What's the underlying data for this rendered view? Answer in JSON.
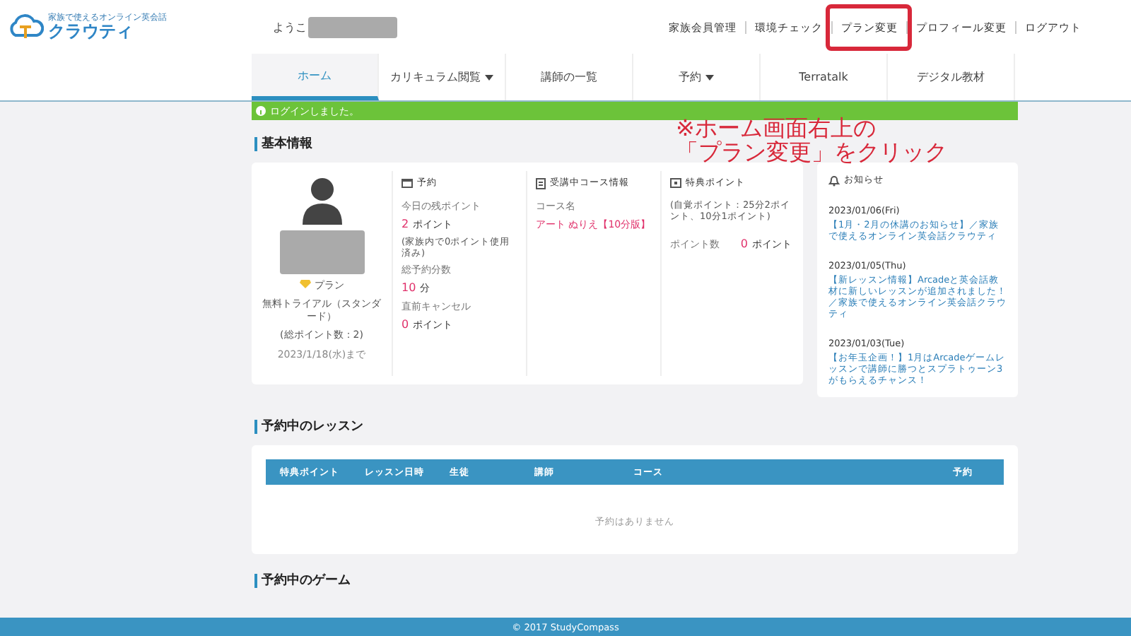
{
  "header": {
    "logo_tagline": "家族で使えるオンライン英会話",
    "logo_text": "クラウティ",
    "welcome": "ようこ",
    "links": [
      {
        "label": "家族会員管理",
        "highlighted": false
      },
      {
        "label": "環境チェック",
        "highlighted": false
      },
      {
        "label": "プラン変更",
        "highlighted": true
      },
      {
        "label": "プロフィール変更",
        "highlighted": false
      },
      {
        "label": "ログアウト",
        "highlighted": false
      }
    ]
  },
  "nav": {
    "tabs": [
      {
        "label": "ホーム",
        "selected": true,
        "dropdown": false
      },
      {
        "label": "カリキュラム閲覧",
        "selected": false,
        "dropdown": true
      },
      {
        "label": "講師の一覧",
        "selected": false,
        "dropdown": false
      },
      {
        "label": "予約",
        "selected": false,
        "dropdown": true
      },
      {
        "label": "Terratalk",
        "selected": false,
        "dropdown": false
      },
      {
        "label": "デジタル教材",
        "selected": false,
        "dropdown": false
      }
    ]
  },
  "alert": "ログインしました。",
  "annotation": [
    "※ホーム画面右上の",
    "「プラン変更」をクリック"
  ],
  "basic_info": {
    "title": "基本情報",
    "profile": {
      "plan_label": "プラン",
      "plan_name": "無料トライアル（スタンダード）",
      "points": "(総ポイント数：2)",
      "expiry": "2023/1/18(水)まで"
    },
    "reservation": {
      "title": "予約",
      "items": [
        {
          "label": "今日の残ポイント",
          "value": "2",
          "unit": "ポイント",
          "note": "(家族内で0ポイント使用済み)"
        },
        {
          "label": "総予約分数",
          "value": "10",
          "unit": "分"
        },
        {
          "label": "直前キャンセル",
          "value": "0",
          "unit": "ポイント"
        }
      ]
    },
    "course": {
      "title": "受講中コース情報",
      "label": "コース名",
      "value": "アート ぬりえ【10分版】"
    },
    "bonus": {
      "title": "特典ポイント",
      "note": "(自覚ポイント：25分2ポイント、10分1ポイント)",
      "label": "ポイント数",
      "value": "0",
      "unit": "ポイント"
    },
    "notices": {
      "title": "お知らせ",
      "items": [
        {
          "date": "2023/01/06(Fri)",
          "text": "【1月・2月の休講のお知らせ】／家族で使えるオンライン英会話クラウティ"
        },
        {
          "date": "2023/01/05(Thu)",
          "text": "【新レッスン情報】Arcadeと英会話教材に新しいレッスンが追加されました！／家族で使えるオンライン英会話クラウティ"
        },
        {
          "date": "2023/01/03(Tue)",
          "text": "【お年玉企画！】1月はArcadeゲームレッスンで講師に勝つとスプラトゥーン3がもらえるチャンス！"
        }
      ]
    }
  },
  "lessons": {
    "title": "予約中のレッスン",
    "columns": [
      "特典ポイント",
      "レッスン日時",
      "生徒",
      "講師",
      "コース",
      "予約"
    ],
    "empty": "予約はありません"
  },
  "games": {
    "title": "予約中のゲーム"
  },
  "footer": "© 2017 StudyCompass"
}
